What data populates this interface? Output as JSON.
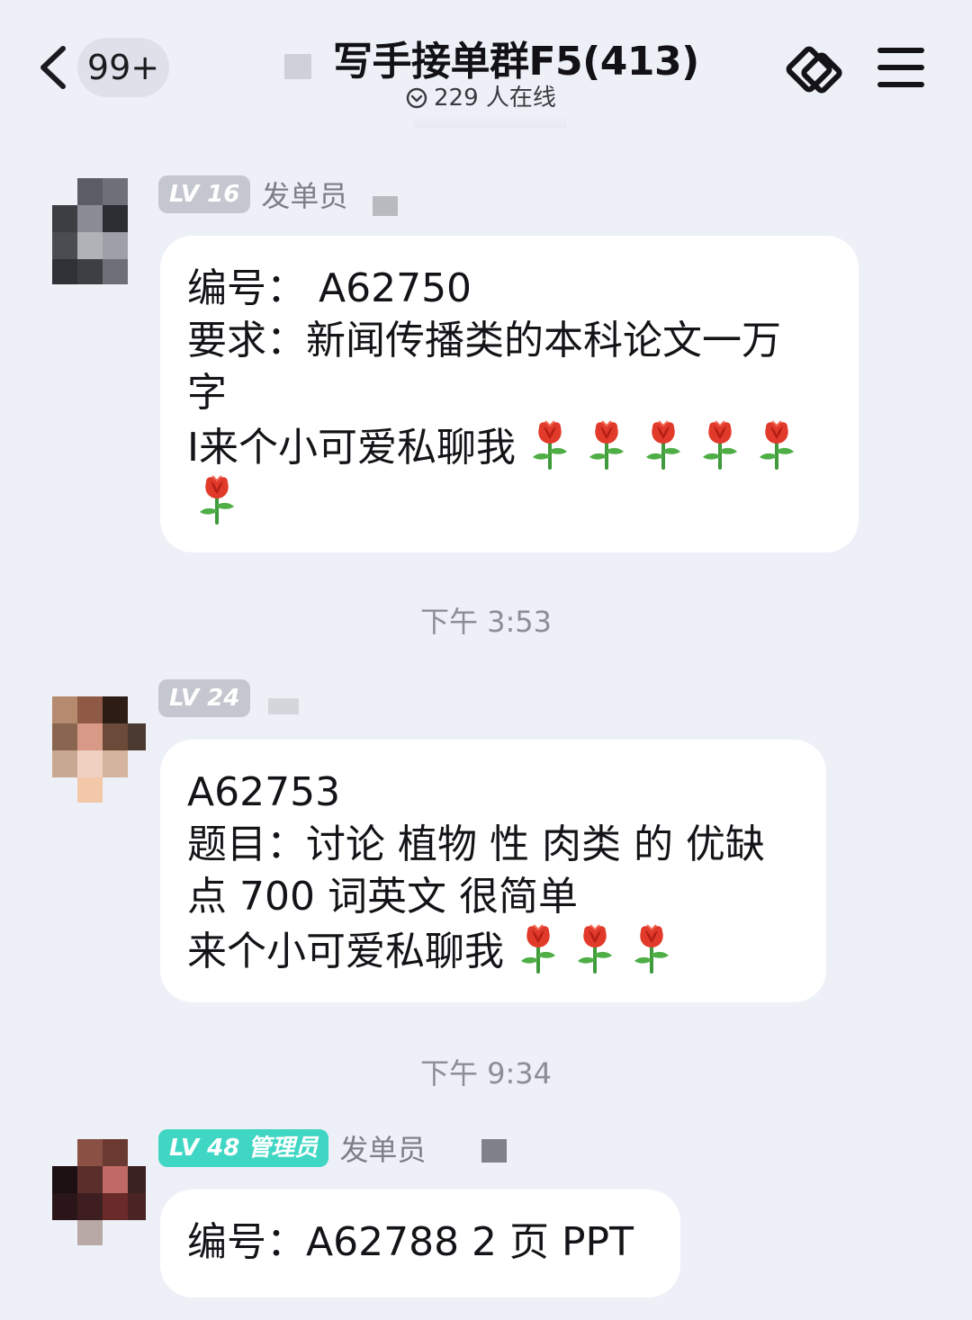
{
  "header": {
    "unread_count": "99+",
    "title": "写手接单群F5(413)",
    "online_status": "229 人在线",
    "icons": [
      "back-chevron-icon",
      "share-link-icon",
      "menu-icon"
    ]
  },
  "messages": [
    {
      "level": "LV 16",
      "role": "发单员",
      "lines": [
        "编号：  A62750",
        "要求：新闻传播类的本科论文一万",
        "字",
        "I来个小可爱私聊我"
      ],
      "roses": 6
    },
    {
      "timestamp": "下午 3:53"
    },
    {
      "level": "LV 24",
      "role": "",
      "lines": [
        "A62753",
        "题目：讨论 植物 性 肉类 的 优缺",
        "点 700 词英文 很简单",
        "来个小可爱私聊我"
      ],
      "roses": 3
    },
    {
      "timestamp": "下午 9:34"
    },
    {
      "level": "LV 48",
      "admin_label": "管理员",
      "role": "发单员",
      "lines": [
        "编号：A62788   2 页 PPT"
      ],
      "roses": 0
    }
  ],
  "colors": {
    "background": "#eef0f8",
    "bubble": "#ffffff",
    "badge_gray": "#c4c7cf",
    "badge_admin": "#3fd6c4",
    "rose_red": "#e23a2a",
    "stem_green": "#3e9a3a"
  }
}
